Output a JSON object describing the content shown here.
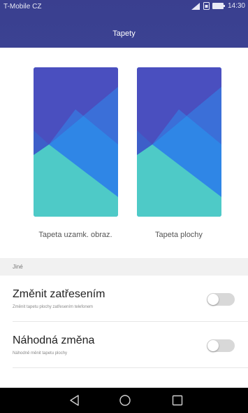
{
  "status_bar": {
    "carrier": "T-Mobile CZ",
    "time": "14:30"
  },
  "header": {
    "title": "Tapety"
  },
  "previews": {
    "lock_label": "Tapeta uzamk. obraz.",
    "home_label": "Tapeta plochy"
  },
  "section": {
    "label": "Jiné"
  },
  "settings": [
    {
      "title": "Změnit zatřesením",
      "subtitle": "Změnit tapetu plochy zatřesením telefonem",
      "enabled": false
    },
    {
      "title": "Náhodná změna",
      "subtitle": "Náhodně měnit tapetu plochy",
      "enabled": false
    }
  ],
  "colors": {
    "header": "#3a3f8f",
    "wallpaper_top": "#4a4fbf",
    "wallpaper_blue": "#2f86e6",
    "wallpaper_teal": "#4ecac7"
  }
}
